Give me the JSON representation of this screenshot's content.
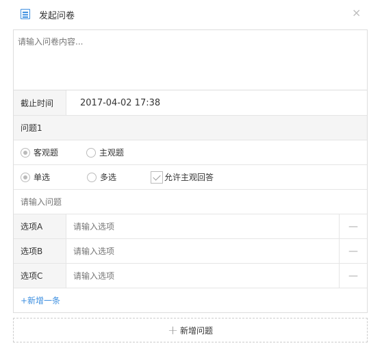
{
  "dialog": {
    "title": "发起问卷",
    "close_glyph": "×"
  },
  "content": {
    "placeholder": "请输入问卷内容..."
  },
  "deadline": {
    "label": "截止时间",
    "value": "2017-04-02 17:38"
  },
  "question": {
    "title": "问题1",
    "type_options": [
      {
        "label": "客观题",
        "selected": true
      },
      {
        "label": "主观题",
        "selected": false
      }
    ],
    "choice_options": [
      {
        "label": "单选",
        "selected": true
      },
      {
        "label": "多选",
        "selected": false
      }
    ],
    "allow_subjective": {
      "label": "允许主观回答",
      "checked": true
    },
    "input_placeholder": "请输入问题",
    "options": [
      {
        "label": "选项A",
        "placeholder": "请输入选项",
        "delete_glyph": "—"
      },
      {
        "label": "选项B",
        "placeholder": "请输入选项",
        "delete_glyph": "—"
      },
      {
        "label": "选项C",
        "placeholder": "请输入选项",
        "delete_glyph": "—"
      }
    ],
    "add_option_label": "+新增一条"
  },
  "add_question": {
    "plus_glyph": "+",
    "label": "新增问题"
  },
  "colors": {
    "accent": "#3d8fe0",
    "border": "#dddddd",
    "label_bg": "#f5f5f5"
  }
}
